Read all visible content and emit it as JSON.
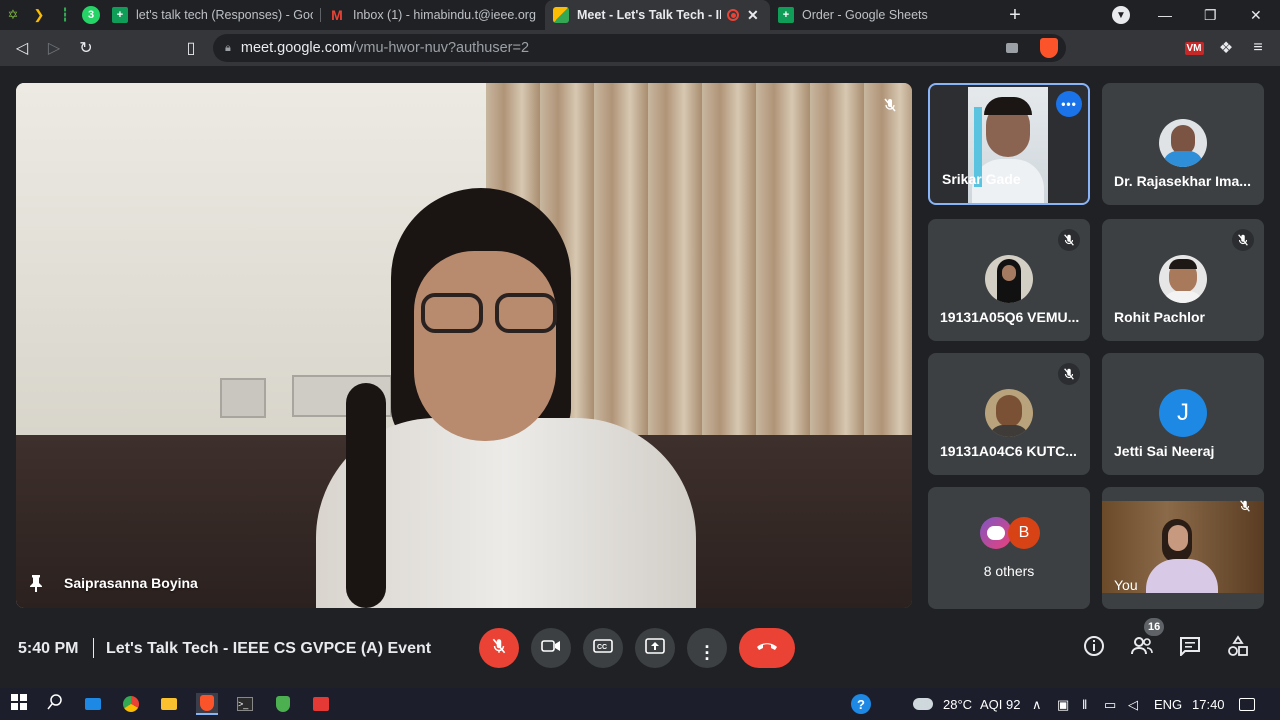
{
  "browser": {
    "tabs": [
      {
        "title": "let's talk tech (Responses) - Google",
        "favicon": "google-sheets-icon",
        "active": false
      },
      {
        "title": "Inbox (1) - himabindu.t@ieee.org -",
        "favicon": "gmail-icon",
        "active": false
      },
      {
        "title": "Meet - Let's Talk Tech - IEE",
        "favicon": "google-meet-icon",
        "active": true
      },
      {
        "title": "Order - Google Sheets",
        "favicon": "google-sheets-icon",
        "active": false
      }
    ],
    "pinned_badge": "3",
    "url_host": "meet.google.com",
    "url_path": "/vmu-hwor-nuv?authuser=2",
    "colors": {
      "sheets": "#0f9d58",
      "gmail": "#ea4335",
      "brave": "#fb542b",
      "recording": "#ea4335"
    }
  },
  "meet": {
    "main_participant": "Saiprasanna Boyina",
    "participants": [
      {
        "name": "Srikar Gade",
        "muted": false,
        "selected": true
      },
      {
        "name": "Dr. Rajasekhar Ima...",
        "muted": false
      },
      {
        "name": "19131A05Q6 VEMU...",
        "muted": true
      },
      {
        "name": "Rohit Pachlor",
        "muted": true
      },
      {
        "name": "19131A04C6 KUTC...",
        "muted": true
      },
      {
        "name": "Jetti Sai Neeraj",
        "muted": false,
        "initial": "J"
      },
      {
        "name": "8 others",
        "muted": false,
        "initial": "B"
      },
      {
        "name": "You",
        "muted": true
      }
    ],
    "clock": "5:40 PM",
    "meeting_title": "Let's Talk Tech - IEEE CS GVPCE (A) Event",
    "participant_count": "16"
  },
  "taskbar": {
    "temperature": "28°C",
    "aqi": "AQI 92",
    "language": "ENG",
    "time": "17:40"
  }
}
